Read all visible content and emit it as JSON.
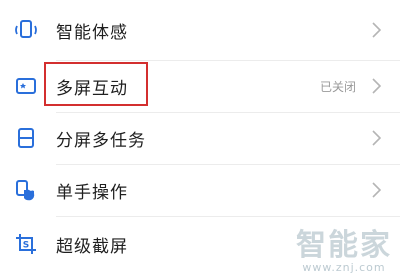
{
  "settings_list": {
    "items": [
      {
        "label": "智能体感",
        "status": "",
        "icon": "device-motion-icon"
      },
      {
        "label": "多屏互动",
        "status": "已关闭",
        "icon": "screen-share-icon"
      },
      {
        "label": "分屏多任务",
        "status": "",
        "icon": "split-screen-icon"
      },
      {
        "label": "单手操作",
        "status": "",
        "icon": "one-hand-icon"
      },
      {
        "label": "超级截屏",
        "status": "",
        "icon": "screenshot-icon"
      }
    ]
  },
  "annotation": {
    "highlight_color": "#d32f2f",
    "target": "多屏互动"
  },
  "colors": {
    "icon_blue": "#2a6fdb",
    "text": "#1f1f1f",
    "secondary": "#9a9a9a"
  },
  "watermark": {
    "big": "智能家",
    "small": "www.znj.com"
  }
}
